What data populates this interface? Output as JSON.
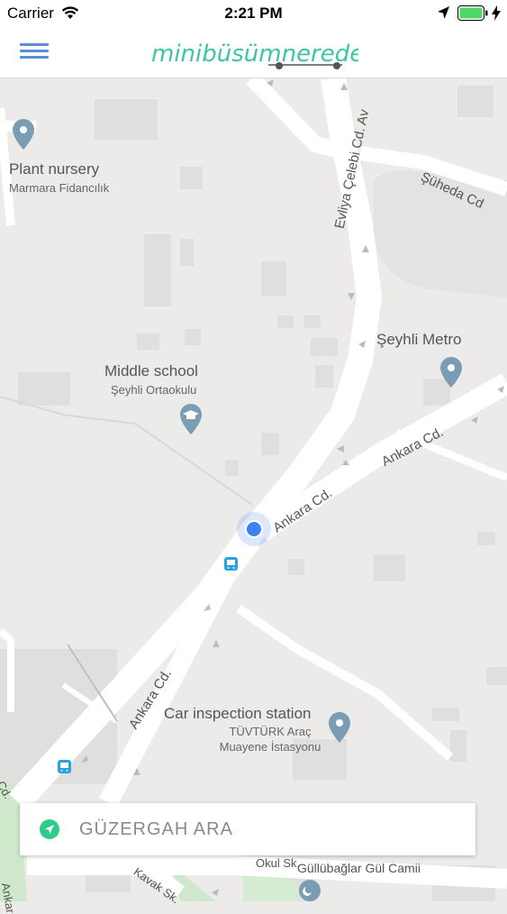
{
  "status_bar": {
    "carrier": "Carrier",
    "time": "2:21 PM"
  },
  "header": {
    "logo_text": "minibüsümnerede"
  },
  "map": {
    "pois": [
      {
        "title": "Plant nursery",
        "subtitle": "Marmara Fidancılık",
        "icon": "pin-icon"
      },
      {
        "title": "Şeyhli Metro",
        "subtitle": "",
        "icon": "pin-icon"
      },
      {
        "title": "Middle school",
        "subtitle": "Şeyhli Ortaokulu",
        "icon": "school-icon"
      },
      {
        "title": "Car inspection station",
        "subtitle": "TÜVTÜRK Araç Muayene İstasyonu",
        "icon": "pin-icon"
      }
    ],
    "streets": {
      "evliya": "Evliya Çelebi Cd. Av",
      "suheda": "Şüheda Cd",
      "ankara1": "Ankara Cd.",
      "ankara2": "Ankara Cd.",
      "ankara3": "Ankara Cd.",
      "okul": "Okul Sk.",
      "gullubaglar": "Güllübağlar Gül Camii",
      "kavak": "Kavak Sk.",
      "ankara4": "Ankar",
      "cd": "Cd."
    }
  },
  "search": {
    "label": "GÜZERGAH ARA"
  },
  "colors": {
    "accent": "#2ecc8a",
    "brand_blue": "#5b8dd6",
    "location_dot": "#3b82f6",
    "map_background": "#ecebea",
    "road": "#ffffff",
    "poi_icon": "#7a9cb5"
  }
}
